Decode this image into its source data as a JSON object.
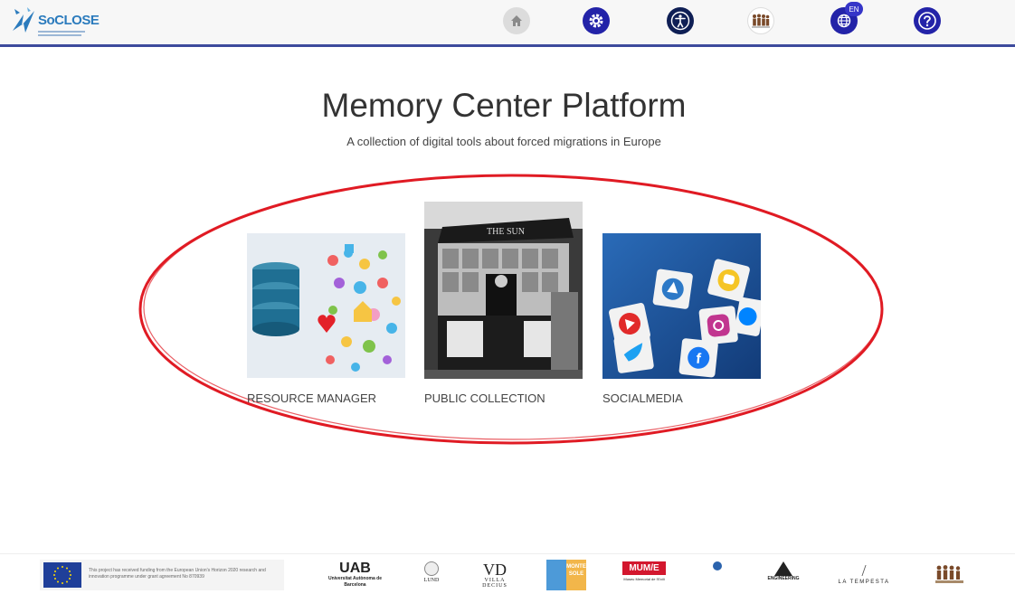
{
  "header": {
    "logo_text": "SoCLOSE",
    "lang_badge": "EN",
    "buttons": [
      {
        "name": "home",
        "icon": "home-icon"
      },
      {
        "name": "settings",
        "icon": "gear-icon"
      },
      {
        "name": "accessibility",
        "icon": "accessibility-icon"
      },
      {
        "name": "community",
        "icon": "people-icon"
      },
      {
        "name": "language",
        "icon": "globe-icon"
      },
      {
        "name": "help",
        "icon": "question-icon"
      }
    ],
    "accent_color": "#3d4a9c"
  },
  "hero": {
    "title": "Memory Center Platform",
    "subtitle": "A collection of digital tools about forced migrations in Europe"
  },
  "cards": [
    {
      "label": "RESOURCE MANAGER",
      "icon": "database-icon"
    },
    {
      "label": "PUBLIC COLLECTION",
      "icon": "newsstand-image"
    },
    {
      "label": "SOCIALMEDIA",
      "icon": "social-cubes-image"
    }
  ],
  "annotation_color": "#e01b24",
  "footer": {
    "funding_text": "This project has received funding from the European Union's Horizon 2020 research and innovation programme under grant agreement No 870939",
    "partners": {
      "uab_big": "UAB",
      "uab_small": "Universitat Autònoma de Barcelona",
      "lund": "LUND",
      "vd_big": "VD",
      "vd_small": "VILLA DECIUS",
      "sole": "MONTE SOLE",
      "mume_big": "MUM/E",
      "mume_small": "Museu Memorial de l'Exili",
      "eng": "ENGINEERING",
      "tempesta": "LA TEMPESTA"
    }
  }
}
